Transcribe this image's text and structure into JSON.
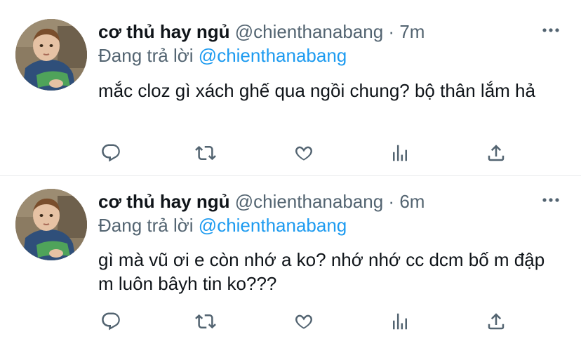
{
  "tweets": [
    {
      "author_name": "cơ thủ hay ngủ",
      "handle": "@chienthanabang",
      "separator": "·",
      "time": "7m",
      "replying_prefix": "Đang trả lời",
      "replying_to": "@chienthanabang",
      "text": "mắc cloz gì xách ghế qua ngồi chung? bộ thân lắm hả"
    },
    {
      "author_name": "cơ thủ hay ngủ",
      "handle": "@chienthanabang",
      "separator": "·",
      "time": "6m",
      "replying_prefix": "Đang trả lời",
      "replying_to": "@chienthanabang",
      "text": "gì mà vũ ơi e còn nhớ a ko? nhớ nhớ cc dcm bố m đập m luôn bâyh tin ko???"
    }
  ],
  "icons": {
    "more": "more-horizontal-icon",
    "reply": "reply-icon",
    "retweet": "retweet-icon",
    "like": "heart-icon",
    "analytics": "analytics-icon",
    "share": "share-icon"
  },
  "colors": {
    "text": "#0f1419",
    "secondary": "#536471",
    "mention": "#1d9bf0",
    "divider": "#e7e9eb"
  }
}
